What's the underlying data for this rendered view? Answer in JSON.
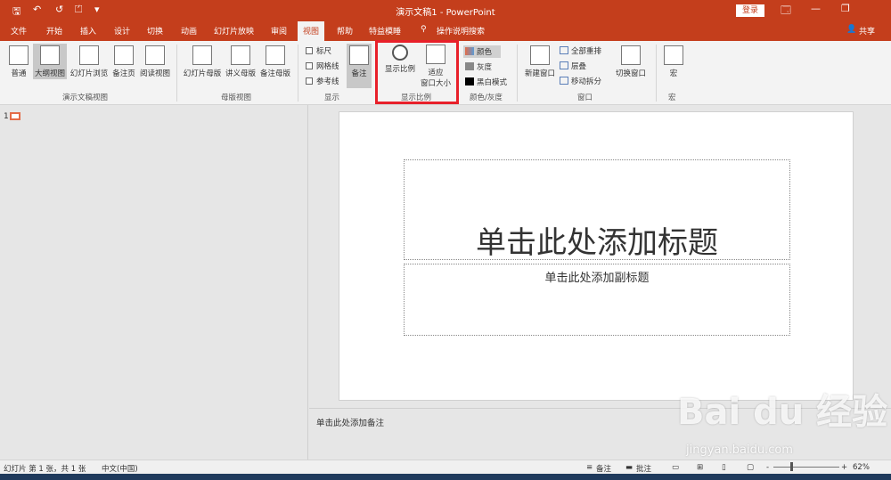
{
  "titlebar": {
    "title": "演示文稿1  -  PowerPoint",
    "login": "登录",
    "qa_save": "🖫",
    "qa_undo": "↶",
    "qa_redo": "↺",
    "qa_start": "⏍",
    "qa_more": "▾",
    "win_ribbon": "🗔",
    "win_min": "—",
    "win_max": "❐"
  },
  "tabs": [
    "文件",
    "开始",
    "插入",
    "设计",
    "切换",
    "动画",
    "幻灯片放映",
    "审阅",
    "视图",
    "帮助",
    "特益模睡",
    "操作说明搜索"
  ],
  "active_tab": "视图",
  "share": "共享",
  "ribbon": {
    "views": [
      "普通",
      "大纲视图",
      "幻灯片浏览",
      "备注页",
      "阅读视图"
    ],
    "views_group": "演示文稿视图",
    "masters": [
      "幻灯片母版",
      "讲义母版",
      "备注母版"
    ],
    "masters_group": "母版视图",
    "show": [
      "标尺",
      "网格线",
      "参考线"
    ],
    "show_notes": "备注",
    "show_group": "显示",
    "zoom": "显示比例",
    "fit": "适应\n窗口大小",
    "zoom_group": "显示比例",
    "colors": [
      "颜色",
      "灰度",
      "黑白模式"
    ],
    "colors_group": "颜色/灰度",
    "new_window": "新建窗口",
    "arrange": [
      "全部重排",
      "层叠",
      "移动拆分"
    ],
    "switch_window": "切换窗口",
    "window_group": "窗口",
    "macro": "宏",
    "macro_group": "宏"
  },
  "slide": {
    "number": "1",
    "title_placeholder": "单击此处添加标题",
    "subtitle_placeholder": "单击此处添加副标题"
  },
  "notes_placeholder": "单击此处添加备注",
  "status": {
    "slide_info": "幻灯片 第 1 张，共 1 张",
    "language": "中文(中国)",
    "notes": "备注",
    "comments": "批注",
    "zoom_minus": "-",
    "zoom_plus": "+",
    "zoom": "62%"
  },
  "watermark": {
    "logo": "Bai du 经验",
    "url": "jingyan.baidu.com"
  }
}
